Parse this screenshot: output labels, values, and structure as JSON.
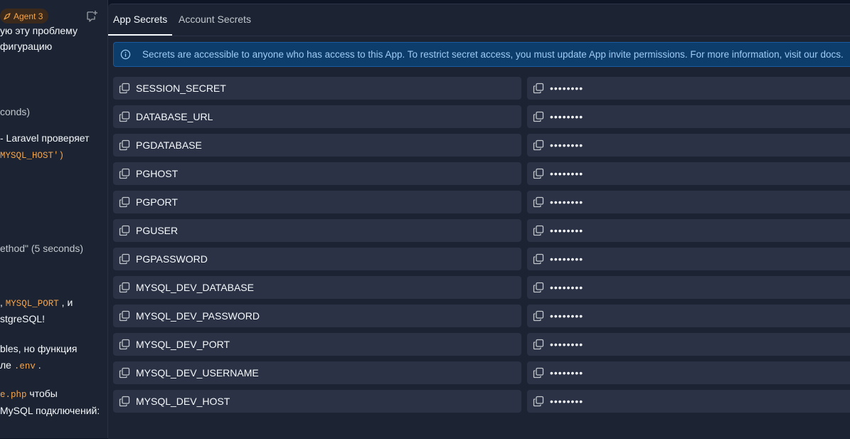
{
  "chat": {
    "agent_badge": "Agent 3",
    "lines": [
      {
        "pre": "ую эту проблему",
        "code": "",
        "post": ""
      },
      {
        "pre": "фигурацию",
        "code": "",
        "post": ""
      },
      {
        "pre": "conds)",
        "code": "",
        "post": ""
      },
      {
        "pre": "- Laravel проверяет",
        "code": "",
        "post": ""
      },
      {
        "pre": "",
        "code": "MYSQL_HOST')",
        "post": ""
      },
      {
        "pre": "ethod\" (5 seconds)",
        "code": "",
        "post": ""
      },
      {
        "pre": ", ",
        "code": "MYSQL_PORT",
        "post": " , и"
      },
      {
        "pre": "stgreSQL!",
        "code": "",
        "post": ""
      },
      {
        "pre": "bles, но функция",
        "code": "",
        "post": ""
      },
      {
        "pre": "ле ",
        "code": ".env",
        "post": " ."
      },
      {
        "pre": "",
        "code": "e.php",
        "post": " чтобы"
      },
      {
        "pre": "MySQL подключений:",
        "code": "",
        "post": ""
      }
    ]
  },
  "tabs": {
    "app_secrets": "App Secrets",
    "account_secrets": "Account Secrets"
  },
  "banner": {
    "text": "Secrets are accessible to anyone who has access to this App. To restrict secret access, you must update App invite permissions. For more information, visit our docs."
  },
  "secrets": [
    {
      "key": "SESSION_SECRET",
      "value": "••••••••"
    },
    {
      "key": "DATABASE_URL",
      "value": "••••••••"
    },
    {
      "key": "PGDATABASE",
      "value": "••••••••"
    },
    {
      "key": "PGHOST",
      "value": "••••••••"
    },
    {
      "key": "PGPORT",
      "value": "••••••••"
    },
    {
      "key": "PGUSER",
      "value": "••••••••"
    },
    {
      "key": "PGPASSWORD",
      "value": "••••••••"
    },
    {
      "key": "MYSQL_DEV_DATABASE",
      "value": "••••••••"
    },
    {
      "key": "MYSQL_DEV_PASSWORD",
      "value": "••••••••"
    },
    {
      "key": "MYSQL_DEV_PORT",
      "value": "••••••••"
    },
    {
      "key": "MYSQL_DEV_USERNAME",
      "value": "••••••••"
    },
    {
      "key": "MYSQL_DEV_HOST",
      "value": "••••••••"
    }
  ],
  "colors": {
    "background": "#0e1525",
    "panel": "#1c2333",
    "row": "#2b3245",
    "banner_bg": "#0c3d6b",
    "banner_text": "#9fcbf5",
    "agent_accent": "#f5a54a"
  }
}
